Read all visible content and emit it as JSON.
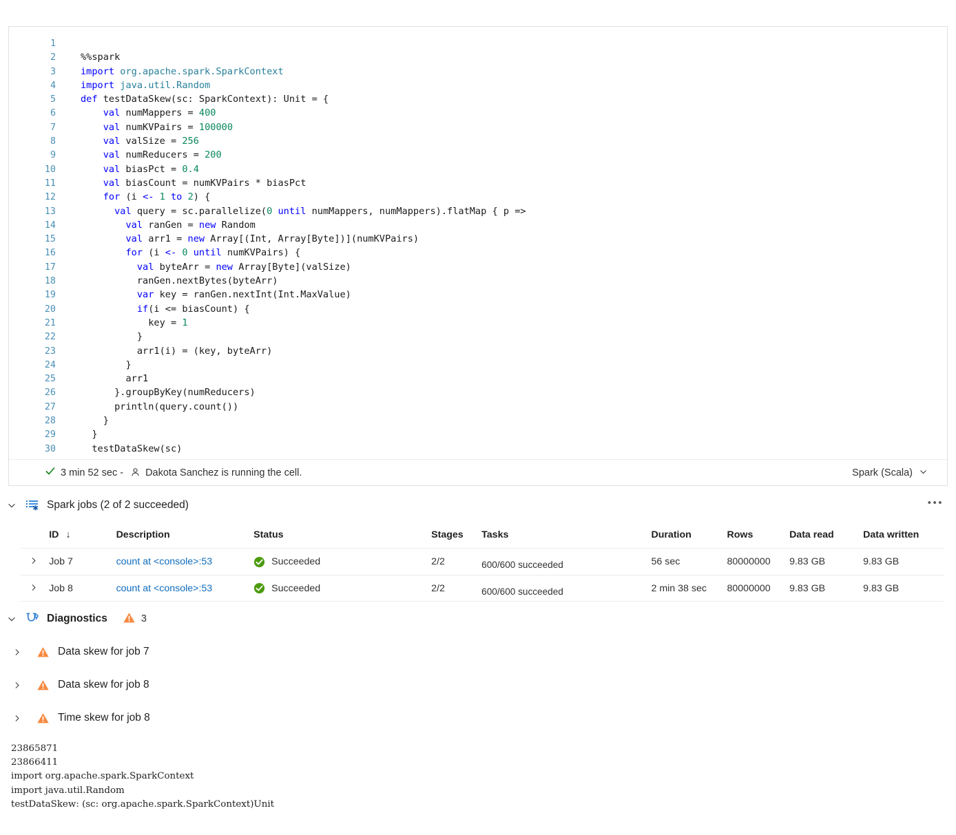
{
  "cell": {
    "language": "Spark (Scala)",
    "status": {
      "duration": "3 min 52 sec -",
      "message": "Dakota Sanchez is running the cell."
    },
    "code_lines": [
      {
        "n": "1",
        "segments": []
      },
      {
        "n": "2",
        "segments": [
          {
            "t": "%%spark",
            "c": "plain"
          }
        ]
      },
      {
        "n": "3",
        "segments": [
          {
            "t": "import ",
            "c": "kw"
          },
          {
            "t": "org.apache.spark.SparkContext",
            "c": "type"
          }
        ]
      },
      {
        "n": "4",
        "segments": [
          {
            "t": "import ",
            "c": "kw"
          },
          {
            "t": "java.util.Random",
            "c": "type"
          }
        ]
      },
      {
        "n": "5",
        "segments": [
          {
            "t": "def ",
            "c": "kw"
          },
          {
            "t": "testDataSkew(sc: SparkContext): Unit = {",
            "c": "plain"
          }
        ]
      },
      {
        "n": "6",
        "segments": [
          {
            "t": "    ",
            "c": "plain"
          },
          {
            "t": "val ",
            "c": "kw"
          },
          {
            "t": "numMappers = ",
            "c": "plain"
          },
          {
            "t": "400",
            "c": "num"
          }
        ]
      },
      {
        "n": "7",
        "segments": [
          {
            "t": "    ",
            "c": "plain"
          },
          {
            "t": "val ",
            "c": "kw"
          },
          {
            "t": "numKVPairs = ",
            "c": "plain"
          },
          {
            "t": "100000",
            "c": "num"
          }
        ]
      },
      {
        "n": "8",
        "segments": [
          {
            "t": "    ",
            "c": "plain"
          },
          {
            "t": "val ",
            "c": "kw"
          },
          {
            "t": "valSize = ",
            "c": "plain"
          },
          {
            "t": "256",
            "c": "num"
          }
        ]
      },
      {
        "n": "9",
        "segments": [
          {
            "t": "    ",
            "c": "plain"
          },
          {
            "t": "val ",
            "c": "kw"
          },
          {
            "t": "numReducers = ",
            "c": "plain"
          },
          {
            "t": "200",
            "c": "num"
          }
        ]
      },
      {
        "n": "10",
        "segments": [
          {
            "t": "    ",
            "c": "plain"
          },
          {
            "t": "val ",
            "c": "kw"
          },
          {
            "t": "biasPct = ",
            "c": "plain"
          },
          {
            "t": "0.4",
            "c": "num"
          }
        ]
      },
      {
        "n": "11",
        "segments": [
          {
            "t": "    ",
            "c": "plain"
          },
          {
            "t": "val ",
            "c": "kw"
          },
          {
            "t": "biasCount = numKVPairs * biasPct",
            "c": "plain"
          }
        ]
      },
      {
        "n": "12",
        "segments": [
          {
            "t": "    ",
            "c": "plain"
          },
          {
            "t": "for ",
            "c": "kw"
          },
          {
            "t": "(i ",
            "c": "plain"
          },
          {
            "t": "<- ",
            "c": "op"
          },
          {
            "t": "1 ",
            "c": "num"
          },
          {
            "t": "to ",
            "c": "op"
          },
          {
            "t": "2",
            "c": "num"
          },
          {
            "t": ") {",
            "c": "plain"
          }
        ]
      },
      {
        "n": "13",
        "segments": [
          {
            "t": "      ",
            "c": "plain"
          },
          {
            "t": "val ",
            "c": "kw"
          },
          {
            "t": "query = sc.parallelize(",
            "c": "plain"
          },
          {
            "t": "0 ",
            "c": "num"
          },
          {
            "t": "until ",
            "c": "op"
          },
          {
            "t": "numMappers, numMappers).flatMap { p =>",
            "c": "plain"
          }
        ]
      },
      {
        "n": "14",
        "segments": [
          {
            "t": "        ",
            "c": "plain"
          },
          {
            "t": "val ",
            "c": "kw"
          },
          {
            "t": "ranGen = ",
            "c": "plain"
          },
          {
            "t": "new ",
            "c": "kw"
          },
          {
            "t": "Random",
            "c": "plain"
          }
        ]
      },
      {
        "n": "15",
        "segments": [
          {
            "t": "        ",
            "c": "plain"
          },
          {
            "t": "val ",
            "c": "kw"
          },
          {
            "t": "arr1 = ",
            "c": "plain"
          },
          {
            "t": "new ",
            "c": "kw"
          },
          {
            "t": "Array[(Int, Array[Byte])](numKVPairs)",
            "c": "plain"
          }
        ]
      },
      {
        "n": "16",
        "segments": [
          {
            "t": "        ",
            "c": "plain"
          },
          {
            "t": "for ",
            "c": "kw"
          },
          {
            "t": "(i ",
            "c": "plain"
          },
          {
            "t": "<- ",
            "c": "op"
          },
          {
            "t": "0 ",
            "c": "num"
          },
          {
            "t": "until ",
            "c": "op"
          },
          {
            "t": "numKVPairs) {",
            "c": "plain"
          }
        ]
      },
      {
        "n": "17",
        "segments": [
          {
            "t": "          ",
            "c": "plain"
          },
          {
            "t": "val ",
            "c": "kw"
          },
          {
            "t": "byteArr = ",
            "c": "plain"
          },
          {
            "t": "new ",
            "c": "kw"
          },
          {
            "t": "Array[Byte](valSize)",
            "c": "plain"
          }
        ]
      },
      {
        "n": "18",
        "segments": [
          {
            "t": "          ranGen.nextBytes(byteArr)",
            "c": "plain"
          }
        ]
      },
      {
        "n": "19",
        "segments": [
          {
            "t": "          ",
            "c": "plain"
          },
          {
            "t": "var ",
            "c": "kw"
          },
          {
            "t": "key = ranGen.nextInt(Int.MaxValue)",
            "c": "plain"
          }
        ]
      },
      {
        "n": "20",
        "segments": [
          {
            "t": "          ",
            "c": "plain"
          },
          {
            "t": "if",
            "c": "kw"
          },
          {
            "t": "(i <= biasCount) {",
            "c": "plain"
          }
        ]
      },
      {
        "n": "21",
        "segments": [
          {
            "t": "            key = ",
            "c": "plain"
          },
          {
            "t": "1",
            "c": "num"
          }
        ]
      },
      {
        "n": "22",
        "segments": [
          {
            "t": "          }",
            "c": "plain"
          }
        ]
      },
      {
        "n": "23",
        "segments": [
          {
            "t": "          arr1(i) = (key, byteArr)",
            "c": "plain"
          }
        ]
      },
      {
        "n": "24",
        "segments": [
          {
            "t": "        }",
            "c": "plain"
          }
        ]
      },
      {
        "n": "25",
        "segments": [
          {
            "t": "        arr1",
            "c": "plain"
          }
        ]
      },
      {
        "n": "26",
        "segments": [
          {
            "t": "      }.groupByKey(numReducers)",
            "c": "plain"
          }
        ]
      },
      {
        "n": "27",
        "segments": [
          {
            "t": "      println(query.count())",
            "c": "plain"
          }
        ]
      },
      {
        "n": "28",
        "segments": [
          {
            "t": "    }",
            "c": "plain"
          }
        ]
      },
      {
        "n": "29",
        "segments": [
          {
            "t": "  }",
            "c": "plain"
          }
        ]
      },
      {
        "n": "30",
        "segments": [
          {
            "t": "  testDataSkew(sc)",
            "c": "plain"
          }
        ]
      }
    ]
  },
  "spark_jobs": {
    "title": "Spark jobs (2 of 2 succeeded)",
    "more_label": "•••",
    "columns": [
      "ID",
      "Description",
      "Status",
      "Stages",
      "Tasks",
      "Duration",
      "Rows",
      "Data read",
      "Data written"
    ],
    "sort_indicator": "↓",
    "rows": [
      {
        "id": "Job 7",
        "description": "count at <console>:53",
        "status": "Succeeded",
        "stages": "2/2",
        "tasks": "600/600 succeeded",
        "tasks_percent": 100,
        "duration": "56 sec",
        "rows": "80000000",
        "data_read": "9.83 GB",
        "data_written": "9.83 GB"
      },
      {
        "id": "Job 8",
        "description": "count at <console>:53",
        "status": "Succeeded",
        "stages": "2/2",
        "tasks": "600/600 succeeded",
        "tasks_percent": 100,
        "duration": "2 min 38 sec",
        "rows": "80000000",
        "data_read": "9.83 GB",
        "data_written": "9.83 GB"
      }
    ]
  },
  "diagnostics": {
    "title": "Diagnostics",
    "warning_count": "3",
    "items": [
      {
        "label": "Data skew for job 7"
      },
      {
        "label": "Data skew for job 8"
      },
      {
        "label": "Time skew for job 8"
      }
    ]
  },
  "output": {
    "lines": [
      "23865871",
      "23866411",
      "import org.apache.spark.SparkContext",
      "import java.util.Random",
      "testDataSkew: (sc: org.apache.spark.SparkContext)Unit"
    ]
  },
  "colors": {
    "accent_blue": "#0f6cbd",
    "success_green": "#6bb700",
    "check_green": "#107c10",
    "warning_orange": "#f7893f",
    "keyword_blue": "#0000ff",
    "type_teal": "#267f99",
    "number_green": "#09885a",
    "line_number": "#4a8fb5"
  }
}
